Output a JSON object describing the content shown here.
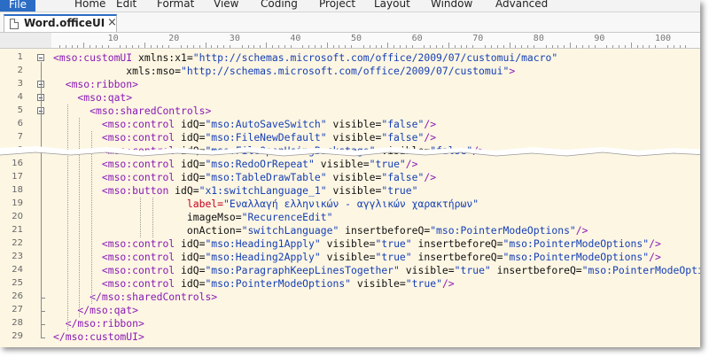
{
  "menu": {
    "items": [
      "File",
      "Home",
      "Edit",
      "Format",
      "View",
      "Coding",
      "Project",
      "Layout",
      "Window",
      "Advanced"
    ]
  },
  "tab": {
    "title": "Word.officeUI",
    "close": "×"
  },
  "ruler": {
    "labels": [
      "10",
      "20",
      "30",
      "40",
      "50",
      "60",
      "70",
      "80",
      "90",
      "100"
    ]
  },
  "lines": [
    {
      "num": "1",
      "parts": [
        [
          "t",
          "<mso:customUI "
        ],
        [
          "a",
          "xmlns:x1="
        ],
        [
          "v",
          "\"http://schemas.microsoft.com/office/2009/07/customui/macro\""
        ]
      ]
    },
    {
      "num": "2",
      "parts": [
        [
          "a",
          "            xmls:mso="
        ],
        [
          "v",
          "\"http://schemas.microsoft.com/office/2009/07/customui\""
        ],
        [
          "t",
          ">"
        ]
      ]
    },
    {
      "num": "3",
      "parts": [
        [
          "t",
          "  <mso:ribbon>"
        ]
      ]
    },
    {
      "num": "4",
      "parts": [
        [
          "t",
          "    <mso:qat>"
        ]
      ]
    },
    {
      "num": "5",
      "parts": [
        [
          "t",
          "      <mso:sharedControls>"
        ]
      ]
    },
    {
      "num": "6",
      "parts": [
        [
          "t",
          "        <mso:control "
        ],
        [
          "a",
          "idQ="
        ],
        [
          "v",
          "\"mso:AutoSaveSwitch\""
        ],
        [
          "a",
          " visible="
        ],
        [
          "v",
          "\"false\""
        ],
        [
          "t",
          "/>"
        ]
      ]
    },
    {
      "num": "7",
      "parts": [
        [
          "t",
          "        <mso:control "
        ],
        [
          "a",
          "idQ="
        ],
        [
          "v",
          "\"mso:FileNewDefault\""
        ],
        [
          "a",
          " visible="
        ],
        [
          "v",
          "\"false\""
        ],
        [
          "t",
          "/>"
        ]
      ]
    },
    {
      "num": "8",
      "parts": [
        [
          "t",
          "        <mso:control "
        ],
        [
          "a",
          "idQ="
        ],
        [
          "v",
          "\"mso:FileOpenUsingBackstage\""
        ],
        [
          "a",
          " visible="
        ],
        [
          "v",
          "\"false\""
        ],
        [
          "t",
          "/>"
        ]
      ]
    },
    {
      "num": "16",
      "parts": [
        [
          "t",
          "        <mso:control "
        ],
        [
          "a",
          "idQ="
        ],
        [
          "v",
          "\"mso:RedoOrRepeat\""
        ],
        [
          "a",
          " visible="
        ],
        [
          "v",
          "\"true\""
        ],
        [
          "t",
          "/>"
        ]
      ]
    },
    {
      "num": "17",
      "parts": [
        [
          "t",
          "        <mso:control "
        ],
        [
          "a",
          "idQ="
        ],
        [
          "v",
          "\"mso:TableDrawTable\""
        ],
        [
          "a",
          " visible="
        ],
        [
          "v",
          "\"false\""
        ],
        [
          "t",
          "/>"
        ]
      ]
    },
    {
      "num": "18",
      "parts": [
        [
          "t",
          "        <mso:button "
        ],
        [
          "a",
          "idQ="
        ],
        [
          "v",
          "\"x1:switchLanguage_1\""
        ],
        [
          "a",
          " visible="
        ],
        [
          "v",
          "\"true\""
        ]
      ]
    },
    {
      "num": "19",
      "parts": [
        [
          "l",
          "                      label="
        ],
        [
          "v",
          "\"Εναλλαγή ελληνικών - αγγλικών χαρακτήρων\""
        ]
      ]
    },
    {
      "num": "20",
      "parts": [
        [
          "a",
          "                      imageMso="
        ],
        [
          "v",
          "\"RecurenceEdit\""
        ]
      ]
    },
    {
      "num": "21",
      "parts": [
        [
          "a",
          "                      onAction="
        ],
        [
          "v",
          "\"switchLanguage\""
        ],
        [
          "a",
          " insertbeforeQ="
        ],
        [
          "v",
          "\"mso:PointerModeOptions\""
        ],
        [
          "t",
          "/>"
        ]
      ]
    },
    {
      "num": "22",
      "parts": [
        [
          "t",
          "        <mso:control "
        ],
        [
          "a",
          "idQ="
        ],
        [
          "v",
          "\"mso:Heading1Apply\""
        ],
        [
          "a",
          " visible="
        ],
        [
          "v",
          "\"true\""
        ],
        [
          "a",
          " insertbeforeQ="
        ],
        [
          "v",
          "\"mso:PointerModeOptions\""
        ],
        [
          "t",
          "/>"
        ]
      ]
    },
    {
      "num": "23",
      "parts": [
        [
          "t",
          "        <mso:control "
        ],
        [
          "a",
          "idQ="
        ],
        [
          "v",
          "\"mso:Heading2Apply\""
        ],
        [
          "a",
          " visible="
        ],
        [
          "v",
          "\"true\""
        ],
        [
          "a",
          " insertbeforeQ="
        ],
        [
          "v",
          "\"mso:PointerModeOptions\""
        ],
        [
          "t",
          "/>"
        ]
      ]
    },
    {
      "num": "24",
      "parts": [
        [
          "t",
          "        <mso:control "
        ],
        [
          "a",
          "idQ="
        ],
        [
          "v",
          "\"mso:ParagraphKeepLinesTogether\""
        ],
        [
          "a",
          " visible="
        ],
        [
          "v",
          "\"true\""
        ],
        [
          "a",
          " insertbeforeQ="
        ],
        [
          "v",
          "\"mso:PointerModeOptions\""
        ],
        [
          "t",
          "/>"
        ]
      ]
    },
    {
      "num": "25",
      "parts": [
        [
          "t",
          "        <mso:control "
        ],
        [
          "a",
          "idQ="
        ],
        [
          "v",
          "\"mso:PointerModeOptions\""
        ],
        [
          "a",
          " visible="
        ],
        [
          "v",
          "\"true\""
        ],
        [
          "t",
          "/>"
        ]
      ]
    },
    {
      "num": "26",
      "parts": [
        [
          "t",
          "      </mso:sharedControls>"
        ]
      ]
    },
    {
      "num": "27",
      "parts": [
        [
          "t",
          "    </mso:qat>"
        ]
      ]
    },
    {
      "num": "28",
      "parts": [
        [
          "t",
          "  </mso:ribbon>"
        ]
      ]
    },
    {
      "num": "29",
      "parts": [
        [
          "t",
          "</mso:customUI>"
        ]
      ]
    }
  ],
  "colors": {
    "tag": "#8a1ab5",
    "value": "#1640b5",
    "attr": "#101010",
    "label": "#c7001f",
    "background": "#fdf6e3",
    "accent": "#2b6cc4"
  }
}
